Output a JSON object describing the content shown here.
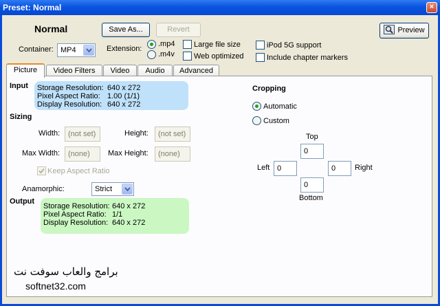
{
  "window": {
    "title": "Preset: Normal",
    "close_glyph": "×"
  },
  "header": {
    "preset_name": "Normal",
    "save_as_label": "Save As...",
    "revert_label": "Revert",
    "preview_label": "Preview",
    "container_label": "Container:",
    "container_value": "MP4",
    "extension_label": "Extension:",
    "ext_mp4": ".mp4",
    "ext_m4v": ".m4v",
    "large_file_label": "Large file size",
    "web_optimized_label": "Web optimized",
    "ipod_label": "iPod 5G support",
    "chapter_label": "Include chapter markers"
  },
  "tabs": [
    {
      "label": "Picture",
      "active": true
    },
    {
      "label": "Video Filters",
      "active": false
    },
    {
      "label": "Video",
      "active": false
    },
    {
      "label": "Audio",
      "active": false
    },
    {
      "label": "Advanced",
      "active": false
    }
  ],
  "picture": {
    "input_title": "Input",
    "input": {
      "storage_label": "Storage Resolution:",
      "storage_value": "640 x 272",
      "par_label": "Pixel Aspect Ratio:",
      "par_value": "1.00 (1/1)",
      "display_label": "Display Resolution:",
      "display_value": "640 x 272"
    },
    "sizing_title": "Sizing",
    "width_label": "Width:",
    "width_value": "(not set)",
    "height_label": "Height:",
    "height_value": "(not set)",
    "max_width_label": "Max Width:",
    "max_width_value": "(none)",
    "max_height_label": "Max Height:",
    "max_height_value": "(none)",
    "keep_aspect_label": "Keep Aspect Ratio",
    "anamorphic_label": "Anamorphic:",
    "anamorphic_value": "Strict",
    "output_title": "Output",
    "output": {
      "storage_label": "Storage Resolution:",
      "storage_value": "640 x 272",
      "par_label": "Pixel Aspect Ratio:",
      "par_value": "1/1",
      "display_label": "Display Resolution:",
      "display_value": "640 x 272"
    },
    "cropping_title": "Cropping",
    "automatic_label": "Automatic",
    "custom_label": "Custom",
    "top_label": "Top",
    "top_value": "0",
    "left_label": "Left",
    "left_value": "0",
    "right_label": "Right",
    "right_value": "0",
    "bottom_label": "Bottom",
    "bottom_value": "0"
  },
  "watermark": {
    "arabic": "برامج والعاب سوفت نت",
    "site": "softnet32.com"
  },
  "colors": {
    "title_bar": "#0b54e0",
    "input_box": "#bfe1fa",
    "output_box": "#cbf7c3",
    "tab_accent": "#e68b2c"
  }
}
